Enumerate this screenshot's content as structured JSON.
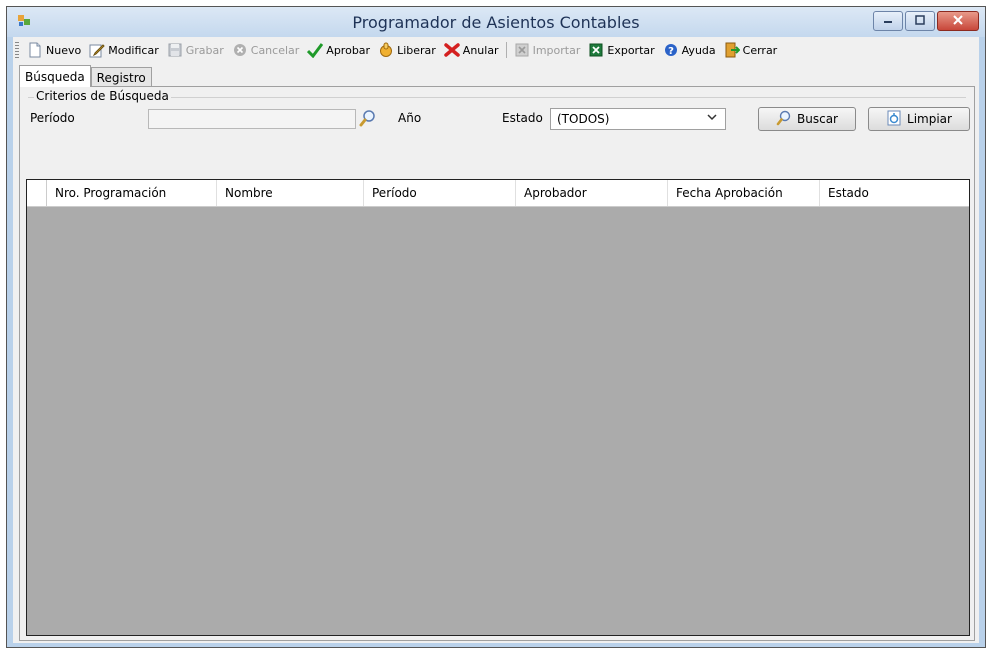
{
  "window": {
    "title": "Programador de Asientos Contables",
    "controls": {
      "minimize": "▭",
      "maximize": "▢",
      "close": "✕"
    }
  },
  "toolbar": {
    "items": [
      {
        "label": "Nuevo",
        "icon": "new-document-icon",
        "enabled": true
      },
      {
        "label": "Modificar",
        "icon": "edit-pencil-icon",
        "enabled": true
      },
      {
        "label": "Grabar",
        "icon": "save-disk-icon",
        "enabled": false
      },
      {
        "label": "Cancelar",
        "icon": "cancel-circle-icon",
        "enabled": false
      },
      {
        "label": "Aprobar",
        "icon": "check-mark-icon",
        "enabled": true
      },
      {
        "label": "Liberar",
        "icon": "release-hand-icon",
        "enabled": true
      },
      {
        "label": "Anular",
        "icon": "red-x-icon",
        "enabled": true
      },
      {
        "label": "Importar",
        "icon": "excel-import-icon",
        "enabled": false
      },
      {
        "label": "Exportar",
        "icon": "excel-export-icon",
        "enabled": true
      },
      {
        "label": "Ayuda",
        "icon": "help-icon",
        "enabled": true
      },
      {
        "label": "Cerrar",
        "icon": "exit-door-icon",
        "enabled": true
      }
    ]
  },
  "tabs": [
    {
      "label": "Búsqueda",
      "active": true
    },
    {
      "label": "Registro",
      "active": false
    }
  ],
  "criteria": {
    "legend": "Criterios de Búsqueda",
    "periodo_label": "Período",
    "periodo_value": "",
    "anio_label": "Año",
    "estado_label": "Estado",
    "estado_value": "(TODOS)",
    "buscar_label": "Buscar",
    "limpiar_label": "Limpiar"
  },
  "grid": {
    "columns": [
      "Nro. Programación",
      "Nombre",
      "Período",
      "Aprobador",
      "Fecha Aprobación",
      "Estado"
    ],
    "rows": []
  },
  "colors": {
    "grid_background": "#ababab",
    "title_text": "#1e3256",
    "close_button": "#c8473a"
  }
}
